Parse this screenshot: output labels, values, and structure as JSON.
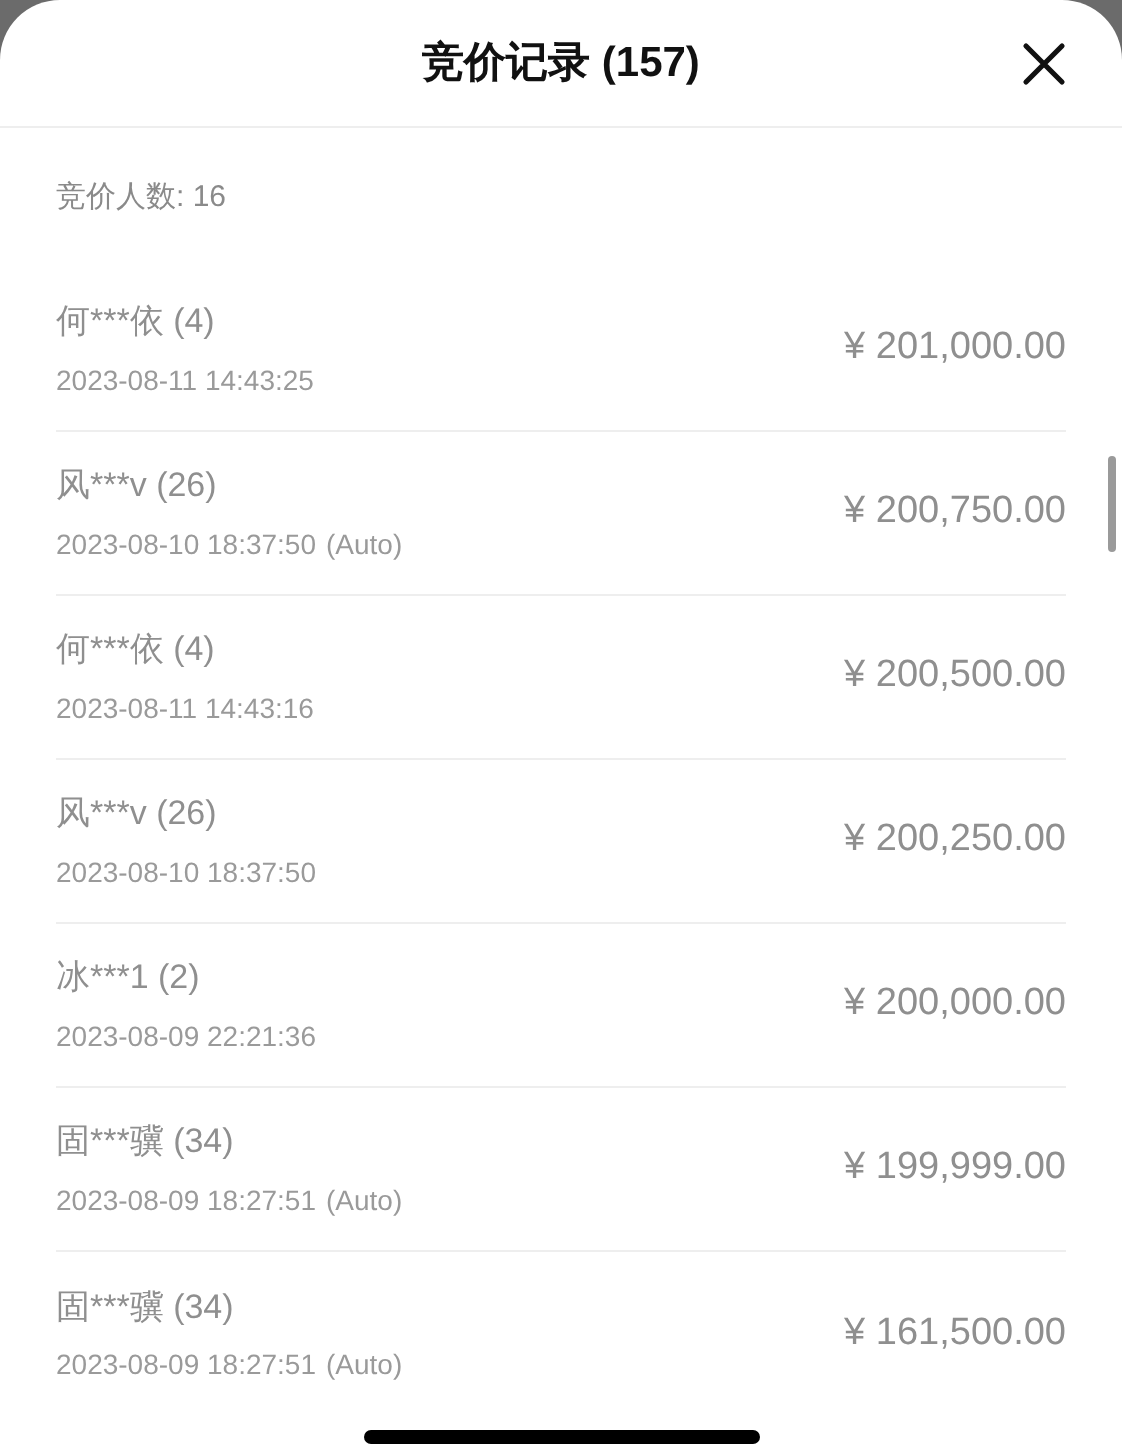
{
  "header": {
    "title": "竞价记录 (157)"
  },
  "bidder_count": "竞价人数: 16",
  "bids": [
    {
      "name": "何***依 (4)",
      "time": "2023-08-11 14:43:25",
      "amount": "¥ 201,000.00"
    },
    {
      "name": "风***v (26)",
      "time": "2023-08-10 18:37:50",
      "note": "(Auto)",
      "amount": "¥ 200,750.00"
    },
    {
      "name": "何***依 (4)",
      "time": "2023-08-11 14:43:16",
      "amount": "¥ 200,500.00"
    },
    {
      "name": "风***v (26)",
      "time": "2023-08-10 18:37:50",
      "amount": "¥ 200,250.00"
    },
    {
      "name": "冰***1 (2)",
      "time": "2023-08-09 22:21:36",
      "amount": "¥ 200,000.00"
    },
    {
      "name": "固***骥 (34)",
      "time": "2023-08-09 18:27:51",
      "note": "(Auto)",
      "amount": "¥ 199,999.00"
    },
    {
      "name": "固***骥 (34)",
      "time": "2023-08-09 18:27:51",
      "note": "(Auto)",
      "amount": "¥ 161,500.00"
    }
  ]
}
